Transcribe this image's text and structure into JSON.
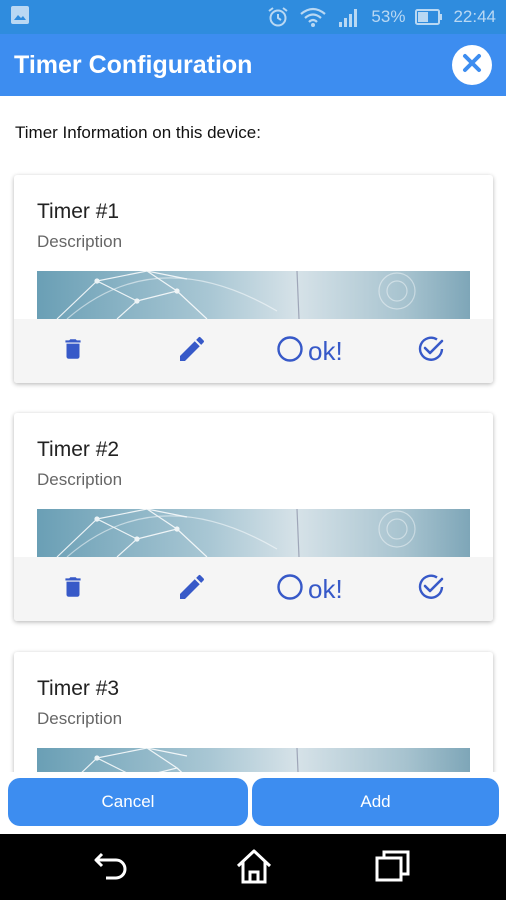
{
  "status_bar": {
    "battery_percent": "53%",
    "time": "22:44",
    "icons": [
      "image-icon",
      "alarm-icon",
      "wifi-icon",
      "signal-icon",
      "battery-icon"
    ]
  },
  "app_bar": {
    "title": "Timer Configuration",
    "close_icon": "close-icon"
  },
  "section_label": "Timer Information on this device:",
  "timers": [
    {
      "title": "Timer #1",
      "description": "Description",
      "ok_label": "ok!"
    },
    {
      "title": "Timer #2",
      "description": "Description",
      "ok_label": "ok!"
    },
    {
      "title": "Timer #3",
      "description": "Description"
    }
  ],
  "actions": {
    "icons": [
      "delete-icon",
      "edit-icon",
      "circle-icon",
      "check-circle-icon"
    ]
  },
  "buttons": {
    "cancel": "Cancel",
    "add": "Add"
  },
  "nav": {
    "icons": [
      "back-icon",
      "home-icon",
      "recents-icon"
    ]
  },
  "colors": {
    "status_bar": "#2f8cde",
    "app_bar": "#3d8df0",
    "accent_icon": "#3759c8",
    "button": "#3d8df0"
  }
}
